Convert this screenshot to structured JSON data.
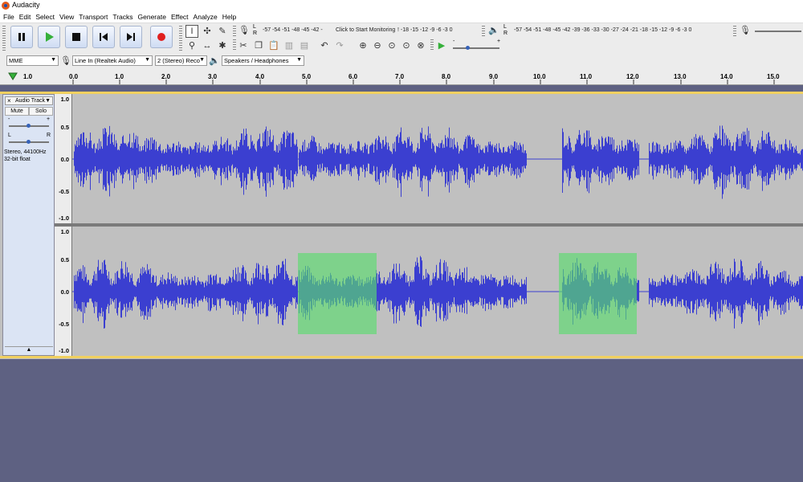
{
  "window": {
    "title": "Audacity"
  },
  "menu": [
    "File",
    "Edit",
    "Select",
    "View",
    "Transport",
    "Tracks",
    "Generate",
    "Effect",
    "Analyze",
    "Help"
  ],
  "transport": {
    "pause": "pause-icon",
    "play": "play-icon",
    "stop": "stop-icon",
    "skip_start": "skip-to-start-icon",
    "skip_end": "skip-to-end-icon",
    "record": "record-icon"
  },
  "meters": {
    "record_ticks": "-57 -54 -51 -48 -45 -42 -",
    "record_prompt": "Click to Start Monitoring",
    "record_ticks_right": "! -18 -15 -12 -9 -6 -3 0",
    "play_ticks": "-57 -54 -51 -48 -45 -42 -39 -36 -33 -30 -27 -24 -21 -18 -15 -12 -9 -6 -3 0",
    "lr_l": "L",
    "lr_r": "R"
  },
  "gain_labels": {
    "minus": "-",
    "plus": "+"
  },
  "device": {
    "host": "MME",
    "input": "Line In (Realtek Audio)",
    "channels": "2 (Stereo) Reco",
    "output": "Speakers / Headphones"
  },
  "ruler": {
    "labels": [
      "1.0",
      "0.0",
      "1.0",
      "2.0",
      "3.0",
      "4.0",
      "5.0",
      "6.0",
      "7.0",
      "8.0",
      "9.0",
      "10.0",
      "11.0",
      "12.0",
      "13.0",
      "14.0",
      "15.0"
    ]
  },
  "track": {
    "name": "Audio Track",
    "close": "×",
    "mute": "Mute",
    "solo": "Solo",
    "gain_minus": "-",
    "gain_plus": "+",
    "pan_l": "L",
    "pan_r": "R",
    "info_line1": "Stereo, 44100Hz",
    "info_line2": "32-bit float",
    "collapse": "▲"
  },
  "vertical_scale": [
    "1.0",
    "0.5",
    "0.0",
    "-0.5",
    "-1.0"
  ],
  "colors": {
    "waveform": "#3b3fd0",
    "selection": "#5adc6e",
    "track_bg": "#c0c0c0",
    "desktop": "#5e6182"
  }
}
